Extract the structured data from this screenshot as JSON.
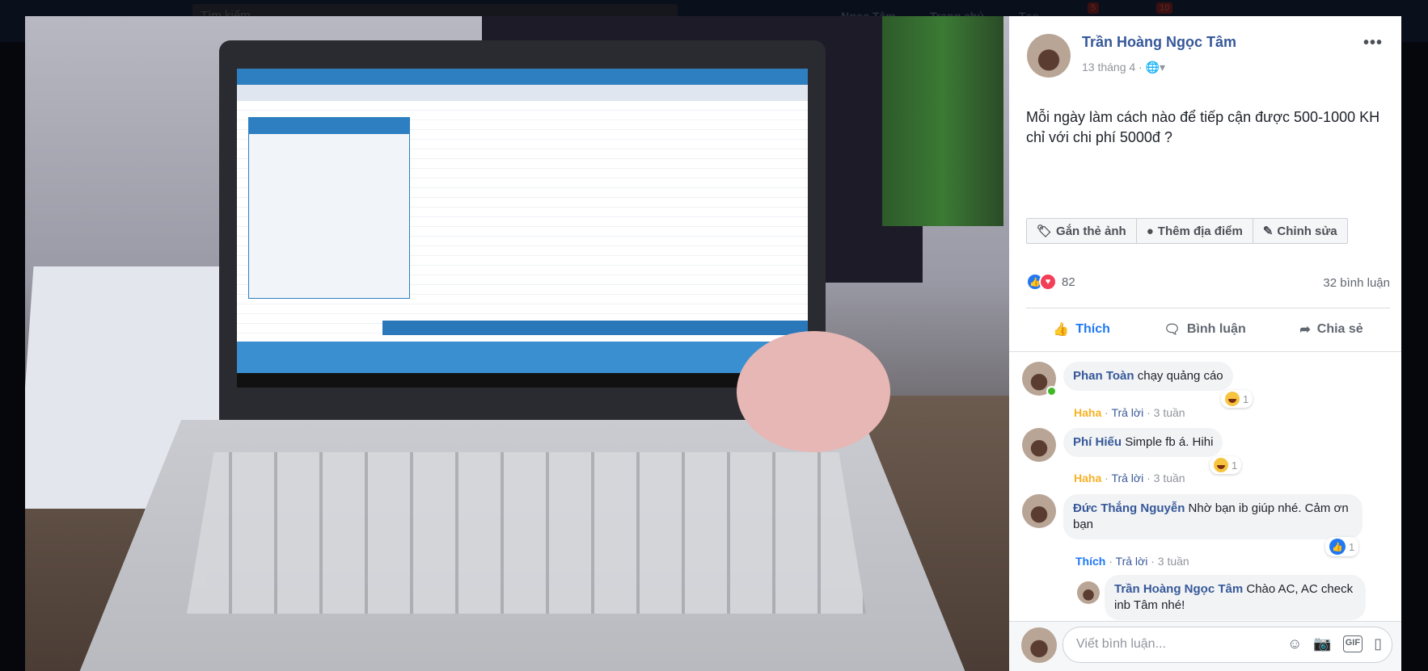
{
  "background_nav": {
    "search_placeholder": "Tìm kiếm",
    "user": "Ngọc Tâm",
    "home": "Trang chủ",
    "create": "Tạo",
    "badges": [
      "5",
      "10"
    ]
  },
  "post": {
    "author": "Trần Hoàng Ngọc Tâm",
    "date": "13 tháng 4",
    "privacy_icon": "globe-icon",
    "text": "Mỗi ngày làm cách nào để tiếp cận được 500-1000 KH chỉ với chi phí 5000đ ?",
    "photo_actions": [
      {
        "label": "Gắn thẻ ảnh",
        "icon": "tag-icon"
      },
      {
        "label": "Thêm địa điểm",
        "icon": "map-pin-icon"
      },
      {
        "label": "Chỉnh sửa",
        "icon": "pencil-icon"
      }
    ],
    "reaction_count": "82",
    "comment_count": "32 bình luận",
    "actions": {
      "like": "Thích",
      "comment": "Bình luận",
      "share": "Chia sẻ"
    }
  },
  "comments": [
    {
      "name": "Phan Toàn",
      "text": "chạy quảng cáo",
      "reaction_label": "Haha",
      "reply": "Trả lời",
      "time": "3 tuần",
      "badge_count": "1",
      "badge": "haha"
    },
    {
      "name": "Phí Hiếu",
      "text": "Simple fb á. Hihi",
      "reaction_label": "Haha",
      "reply": "Trả lời",
      "time": "3 tuần",
      "badge_count": "1",
      "badge": "haha"
    },
    {
      "name": "Đức Thắng Nguyễn",
      "text": "Nhờ bạn ib giúp nhé. Cảm ơn bạn",
      "reaction_label": "Thích",
      "reply": "Trả lời",
      "time": "3 tuần",
      "badge_count": "1",
      "badge": "like"
    }
  ],
  "reply": {
    "name": "Trần Hoàng Ngọc Tâm",
    "text": "Chào AC, AC check inb Tâm nhé!"
  },
  "composer": {
    "placeholder": "Viết bình luận..."
  },
  "colors": {
    "link": "#365899",
    "like": "#2078f4",
    "haha": "#f7b125",
    "love": "#f33e58"
  }
}
